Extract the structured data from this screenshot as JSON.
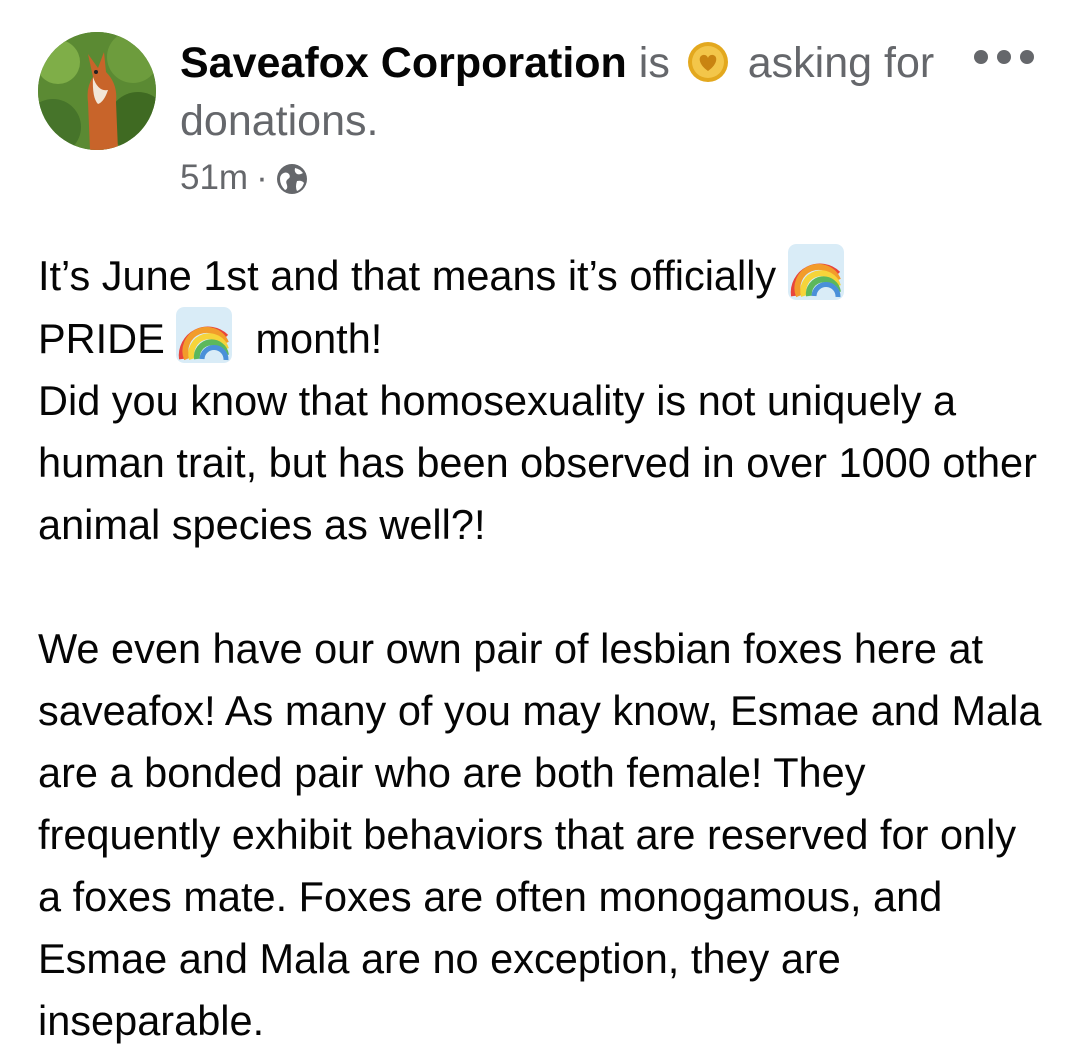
{
  "post": {
    "page_name": "Saveafox Corporation",
    "status_is": "is",
    "status_activity": "asking for donations.",
    "timestamp": "51m",
    "separator": "·",
    "privacy_icon": "globe-icon",
    "avatar_icon": "fox-avatar",
    "status_icon": "heart-coin-icon",
    "more_icon": "more-options-icon"
  },
  "body": {
    "p1_part1": "It’s June 1st and that means it’s officially",
    "p1_part2": "PRIDE",
    "p1_part3": "month!",
    "p2": "Did you know that homosexuality is not uniquely a human trait, but has been observed in over 1000 other animal species as well?!",
    "p3": "We even have our own pair of lesbian foxes here at saveafox! As many of you may know, Esmae and Mala are a bonded pair who are both female! They frequently exhibit behaviors that are reserved for only a foxes mate. Foxes are often monogamous, and Esmae and Mala are no exception, they are inseparable.",
    "emoji_icon": "rainbow-emoji"
  },
  "colors": {
    "text_primary": "#050505",
    "text_secondary": "#65676b",
    "background": "#ffffff"
  }
}
